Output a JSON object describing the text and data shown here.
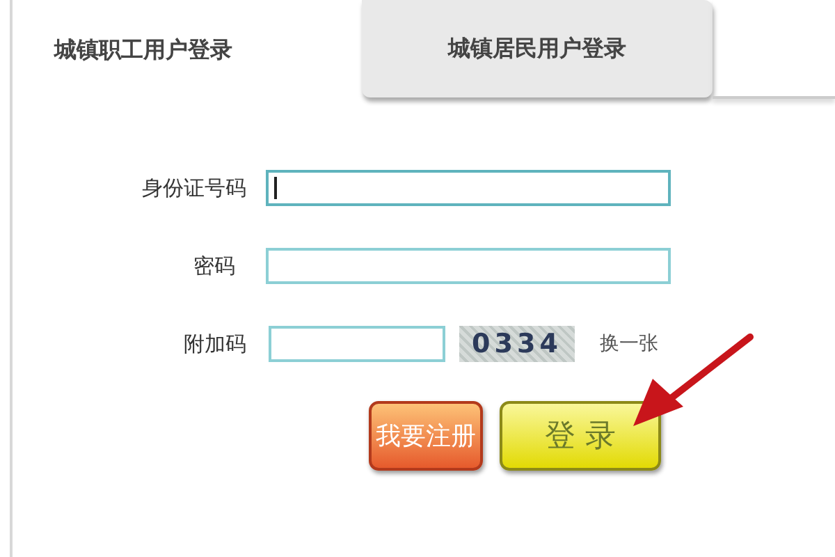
{
  "tabs": [
    {
      "label": "城镇职工用户登录",
      "selected": true
    },
    {
      "label": "城镇居民用户登录",
      "selected": false
    }
  ],
  "fields": [
    {
      "label": "身份证号码",
      "kind": "text",
      "focused": true
    },
    {
      "label": "密码",
      "kind": "password",
      "focused": false
    },
    {
      "label": "附加码",
      "kind": "captcha",
      "focused": false,
      "captcha": "0334",
      "refresh": "换一张"
    }
  ],
  "buttons": [
    {
      "label": "我要注册",
      "kind": "register"
    },
    {
      "label": "登 录",
      "kind": "login"
    }
  ],
  "annotation": {
    "kind": "arrow"
  }
}
